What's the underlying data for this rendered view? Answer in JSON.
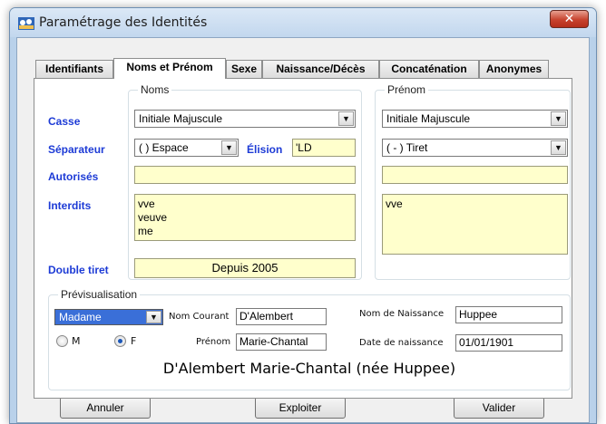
{
  "window": {
    "title": "Paramétrage des Identités",
    "close_symbol": "✕"
  },
  "tabs": [
    "Identifiants",
    "Noms et Prénom",
    "Sexe",
    "Naissance/Décès",
    "Concaténation",
    "Anonymes"
  ],
  "active_tab": "Noms et Prénom",
  "noms_group": {
    "title": "Noms"
  },
  "prenom_group": {
    "title": "Prénom"
  },
  "labels": {
    "casse": "Casse",
    "separateur": "Séparateur",
    "elision": "Élision",
    "autorises": "Autorisés",
    "interdits": "Interdits",
    "double_tiret": "Double tiret"
  },
  "noms": {
    "casse": "Initiale Majuscule",
    "separateur": "( ) Espace",
    "elision": "'LD",
    "autorises": "",
    "interdits": [
      "vve",
      "veuve",
      "me"
    ],
    "double_tiret": "Depuis 2005"
  },
  "prenom": {
    "casse": "Initiale Majuscule",
    "separateur": "( - ) Tiret",
    "autorises": "",
    "interdits": [
      "vve"
    ]
  },
  "preview": {
    "title": "Prévisualisation",
    "civilite": "Madame",
    "label_nom_courant": "Nom Courant",
    "nom_courant": "D'Alembert",
    "label_prenom": "Prénom",
    "prenom": "Marie-Chantal",
    "label_nom_naissance": "Nom de Naissance",
    "nom_naissance": "Huppee",
    "label_date_naissance": "Date de naissance",
    "date_naissance": "01/01/1901",
    "radio_m": "M",
    "radio_f": "F",
    "selected_sex": "F",
    "result": "D'Alembert Marie-Chantal (née Huppee)"
  },
  "buttons": {
    "annuler": "Annuler",
    "exploiter": "Exploiter",
    "valider": "Valider"
  },
  "colors": {
    "label_blue": "#1d3bd6",
    "field_yellow": "#ffffcc",
    "selected_blue": "#3a6fd8",
    "close_red": "#c7422d"
  }
}
